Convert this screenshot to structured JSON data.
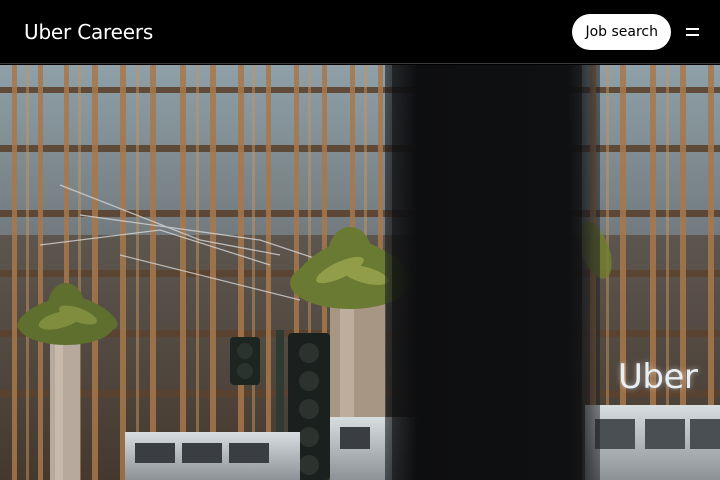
{
  "header": {
    "brand": "Uber Careers",
    "job_search_label": "Job search",
    "menu_icon": "hamburger-menu-icon"
  },
  "hero": {
    "image_description": "Uber headquarters building facade with palm trees, traffic light and streetcar",
    "building_sign": "Uber"
  },
  "colors": {
    "header_bg": "#000000",
    "button_bg": "#ffffff",
    "button_text": "#000000"
  }
}
